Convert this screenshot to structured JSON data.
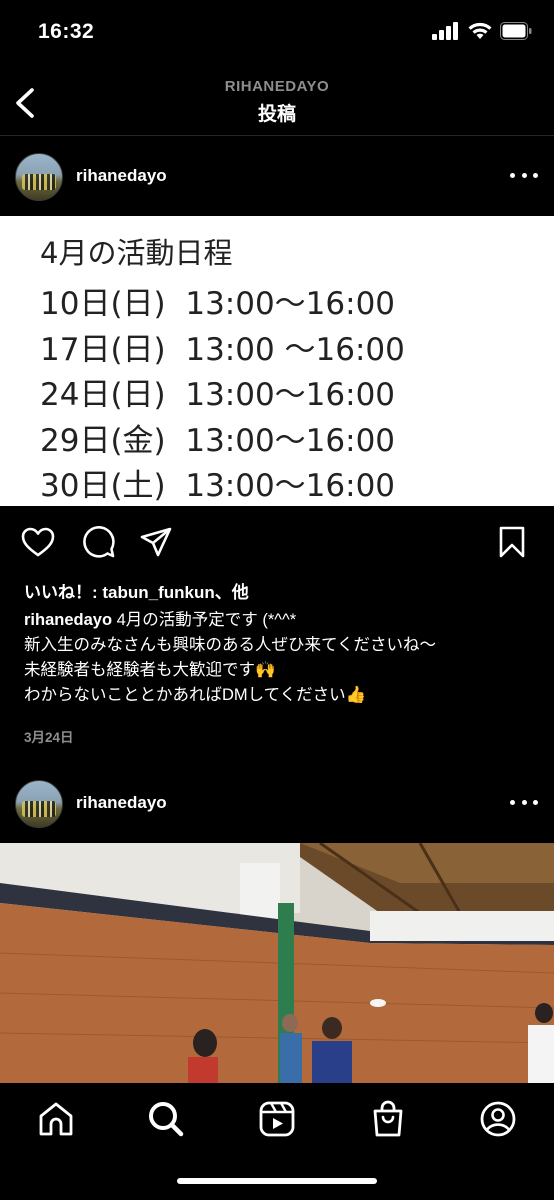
{
  "status_bar": {
    "time": "16:32"
  },
  "header": {
    "username": "RIHANEDAYO",
    "title": "投稿"
  },
  "post1": {
    "username": "rihanedayo",
    "image": {
      "title": "4月の活動日程",
      "rows": [
        "10日(日)  13:00〜16:00",
        "17日(日)  13:00 〜16:00",
        "24日(日)  13:00〜16:00",
        "29日(金)  13:00〜16:00",
        "30日(土)  13:00〜16:00"
      ]
    },
    "likes": "いいね！: tabun_funkun、他",
    "caption_user": "rihanedayo",
    "caption_lines": [
      " 4月の活動予定です (*^^*",
      "新入生のみなさんも興味のある人ぜひ来てくださいね〜",
      "未経験者も経験者も大歓迎です🙌",
      "わからないこととかあればDMしてください👍"
    ],
    "date": "3月24日"
  },
  "post2": {
    "username": "rihanedayo"
  },
  "icons": {
    "back": "chevron-left-icon",
    "like": "heart-icon",
    "comment": "comment-icon",
    "share": "send-icon",
    "save": "bookmark-icon",
    "nav": [
      "home-icon",
      "search-icon",
      "reels-icon",
      "shop-icon",
      "profile-icon"
    ]
  }
}
